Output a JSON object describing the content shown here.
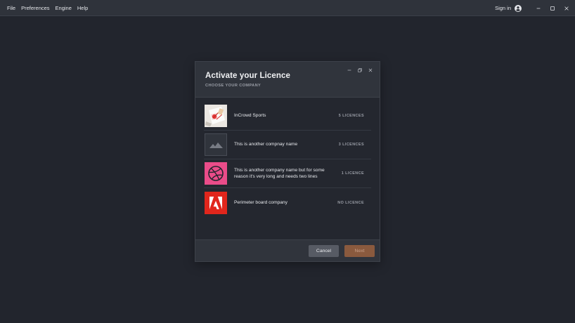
{
  "menubar": {
    "items": [
      {
        "label": "File"
      },
      {
        "label": "Preferences"
      },
      {
        "label": "Engine"
      },
      {
        "label": "Help"
      }
    ],
    "signin_label": "Sign in",
    "icons": {
      "avatar": "account-circle-icon",
      "minimize": "minimize-icon",
      "maximize": "maximize-icon",
      "close": "close-icon"
    }
  },
  "dialog": {
    "title": "Activate your Licence",
    "subtitle": "CHOOSE YOUR COMPANY",
    "companies": [
      {
        "name": "InCrowd Sports",
        "licence": "5 LICENCES",
        "logo": "incrowd-sports-logo"
      },
      {
        "name": "This is another compnay name",
        "licence": "3 LICENCES",
        "logo": "image-placeholder-icon"
      },
      {
        "name": "This is another company name but for some reason it's very long and needs two lines",
        "licence": "1 LICENCE",
        "logo": "dribbble-logo",
        "color": "#ea4c89"
      },
      {
        "name": "Perimeter board company",
        "licence": "NO LICENCE",
        "logo": "adobe-logo",
        "color": "#e1261c"
      }
    ],
    "buttons": {
      "cancel": "Cancel",
      "next": "Next"
    }
  },
  "colors": {
    "background": "#22252d",
    "accent_next": "#8a5a3e",
    "dribbble": "#ea4c89",
    "adobe": "#e1261c"
  }
}
